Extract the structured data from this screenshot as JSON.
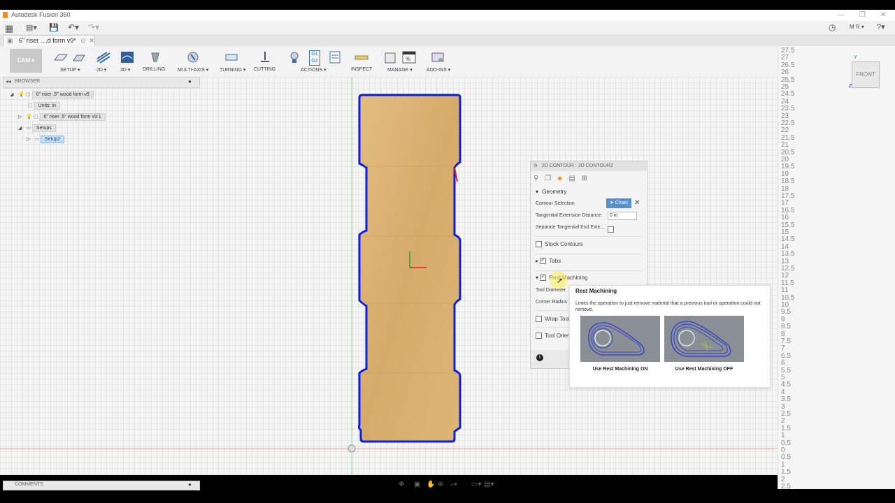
{
  "app": {
    "title": "Autodesk Fusion 360"
  },
  "quick_access": {
    "user": "M R"
  },
  "document": {
    "tab_title": "6\" riser ....d form v9*"
  },
  "ribbon": {
    "workspace": "CAM",
    "groups": [
      {
        "label": "SETUP",
        "dropdown": true
      },
      {
        "label": "2D",
        "dropdown": true
      },
      {
        "label": "3D",
        "dropdown": true
      },
      {
        "label": "DRILLING",
        "dropdown": false
      },
      {
        "label": "MULTI-AXIS",
        "dropdown": true
      },
      {
        "label": "TURNING",
        "dropdown": true
      },
      {
        "label": "CUTTING",
        "dropdown": false
      },
      {
        "label": "ACTIONS",
        "dropdown": true
      },
      {
        "label": "INSPECT",
        "dropdown": false
      },
      {
        "label": "MANAGE",
        "dropdown": true
      },
      {
        "label": "ADD-INS",
        "dropdown": true
      }
    ],
    "actions_icon_text": {
      "g1": "G1",
      "g2": "G2"
    }
  },
  "browser": {
    "title": "BROWSER",
    "root": "6\" riser .5\" wood form v9",
    "units": "Units: in",
    "component": "6\" riser .5\" wood form v9:1",
    "setups": "Setups",
    "setup": "Setup2"
  },
  "comments": {
    "title": "COMMENTS"
  },
  "viewcube": {
    "face": "FRONT",
    "axis_y": "Y",
    "axis_z": "Z"
  },
  "ruler": {
    "ticks": [
      "27.5",
      "27",
      "26.5",
      "26",
      "25.5",
      "25",
      "24.5",
      "24",
      "23.5",
      "23",
      "22.5",
      "22",
      "21.5",
      "21",
      "20.5",
      "20",
      "19.5",
      "19",
      "18.5",
      "18",
      "17.5",
      "17",
      "16.5",
      "16",
      "15.5",
      "15",
      "14.5",
      "14",
      "13.5",
      "13",
      "12.5",
      "12",
      "11.5",
      "11",
      "10.5",
      "10",
      "9.5",
      "9",
      "8.5",
      "8",
      "7.5",
      "7",
      "6.5",
      "6",
      "5.5",
      "5",
      "4.5",
      "4",
      "3.5",
      "3",
      "2.5",
      "2",
      "1.5",
      "1",
      "0.5",
      "0",
      "0.5",
      "1",
      "1.5",
      "2",
      "2.5"
    ]
  },
  "panel": {
    "title": "2D CONTOUR : 2D CONTOUR2",
    "geometry": "Geometry",
    "contour_selection": "Contour Selection",
    "chain_button": "Chain",
    "tangential_extension": "Tangential Extension Distance",
    "tangential_value": "0 in",
    "separate_tangential": "Separate Tangential End Exte...",
    "stock_contours": "Stock Contours",
    "tabs": "Tabs",
    "rest_machining": "Rest Machining",
    "tool_diameter": "Tool Diameter",
    "corner_radius": "Corner Radius",
    "wrap_tool": "Wrap Tool",
    "tool_orient": "Tool Orien",
    "info": "i"
  },
  "tooltip": {
    "title": "Rest Machining",
    "description": "Limits the operation to just remove material that a previous tool or operation could not remove.",
    "caption_on": "Use Rest Machining ON",
    "caption_off": "Use Rest Machining OFF"
  },
  "colors": {
    "contour": "#0a1ee0",
    "wood": "#d9b071",
    "chain_button": "#5a8fc8",
    "axis_x": "#e02020",
    "axis_y": "#20a020"
  }
}
